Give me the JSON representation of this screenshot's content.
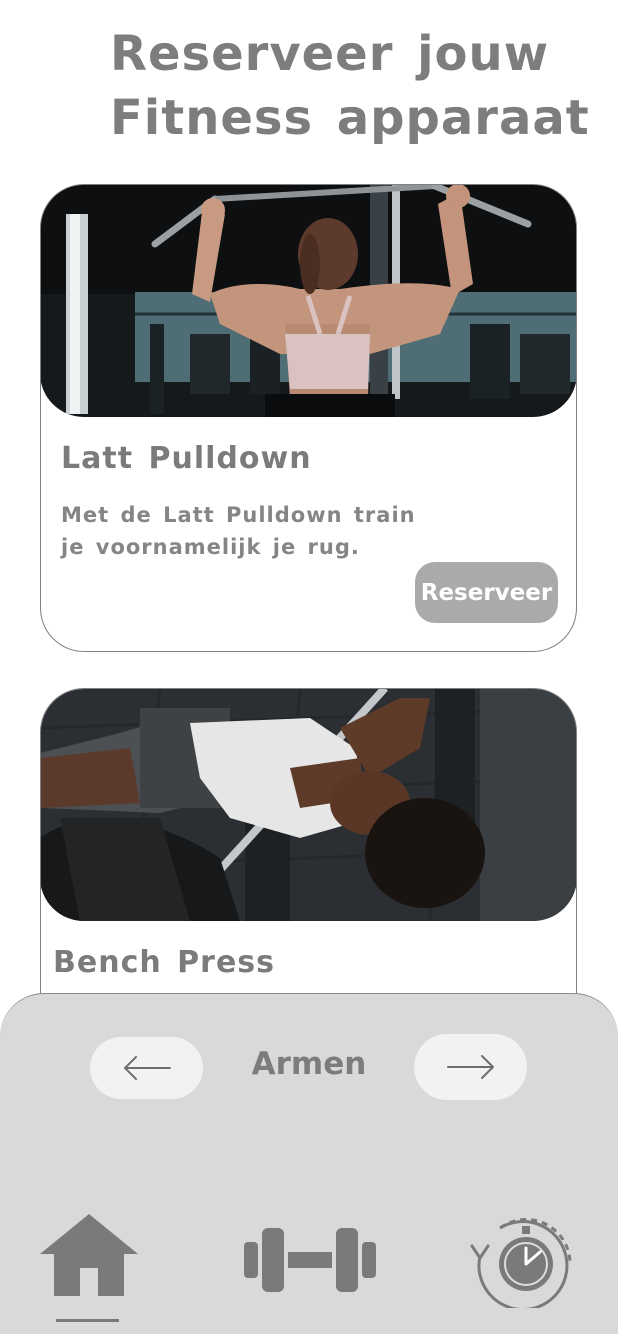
{
  "header": {
    "title_line1": "Reserveer jouw",
    "title_line2": "Fitness apparaat"
  },
  "cards": [
    {
      "title": "Latt Pulldown",
      "description": "Met de Latt Pulldown train je voornamelijk je rug.",
      "button_label": "Reserveer"
    },
    {
      "title": "Bench Press"
    }
  ],
  "category_nav": {
    "current": "Armen",
    "prev_icon": "arrow-left-icon",
    "next_icon": "arrow-right-icon"
  },
  "tab_bar": {
    "items": [
      {
        "icon": "home-icon",
        "active": true
      },
      {
        "icon": "dumbbell-icon",
        "active": false
      },
      {
        "icon": "history-clock-icon",
        "active": false
      }
    ]
  },
  "colors": {
    "text": "#7d7d7d",
    "button": "#aaaaa8",
    "panel": "#d9d9d9",
    "nav_button": "#f2f2f2",
    "icon": "#7a7a78"
  }
}
